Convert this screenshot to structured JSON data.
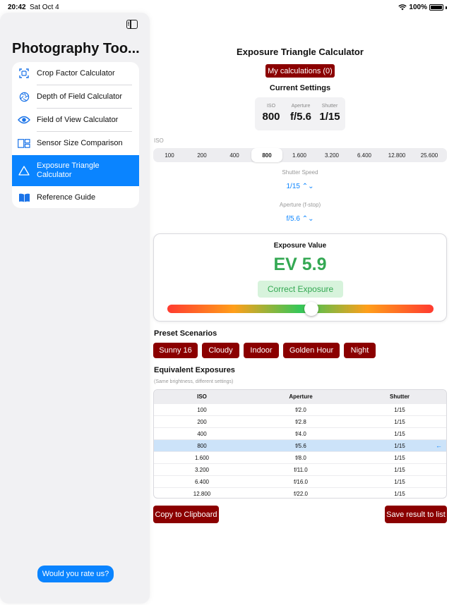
{
  "status": {
    "time": "20:42",
    "date": "Sat Oct 4",
    "battery": "100%"
  },
  "sidebar": {
    "title": "Photography Too...",
    "items": [
      {
        "label": "Crop Factor Calculator",
        "icon": "crop-icon"
      },
      {
        "label": "Depth of Field Calculator",
        "icon": "aperture-icon"
      },
      {
        "label": "Field of View Calculator",
        "icon": "eye-icon"
      },
      {
        "label": "Sensor Size Comparison",
        "icon": "sensor-compare-icon"
      },
      {
        "label": "Exposure Triangle Calculator",
        "icon": "triangle-icon",
        "selected": true
      },
      {
        "label": "Reference Guide",
        "icon": "book-icon"
      }
    ],
    "rate_button": "Would you rate us?"
  },
  "main": {
    "title": "Exposure Triangle Calculator",
    "my_calcs_button": "My calculations (0)",
    "current_settings": {
      "title": "Current Settings",
      "iso_label": "ISO",
      "iso_value": "800",
      "aperture_label": "Aperture",
      "aperture_value": "f/5.6",
      "shutter_label": "Shutter",
      "shutter_value": "1/15"
    },
    "iso": {
      "label": "ISO",
      "options": [
        "100",
        "200",
        "400",
        "800",
        "1.600",
        "3.200",
        "6.400",
        "12.800",
        "25.600"
      ],
      "selected": "800"
    },
    "shutter": {
      "label": "Shutter Speed",
      "value": "1/15 ⌃⌄"
    },
    "aperture": {
      "label": "Aperture (f-stop)",
      "value": "f/5.6 ⌃⌄"
    },
    "exposure": {
      "title": "Exposure Value",
      "value": "EV 5.9",
      "status": "Correct Exposure",
      "meter_fraction": 0.54,
      "colors": {
        "green": "#34a853",
        "status_bg": "#d7f3dc"
      }
    },
    "presets": {
      "title": "Preset Scenarios",
      "items": [
        "Sunny 16",
        "Cloudy",
        "Indoor",
        "Golden Hour",
        "Night"
      ]
    },
    "equivalent": {
      "title": "Equivalent Exposures",
      "note": "(Same brightness, different settings)",
      "headers": [
        "ISO",
        "Aperture",
        "Shutter"
      ],
      "rows": [
        [
          "100",
          "f/2.0",
          "1/15"
        ],
        [
          "200",
          "f/2.8",
          "1/15"
        ],
        [
          "400",
          "f/4.0",
          "1/15"
        ],
        [
          "800",
          "f/5.6",
          "1/15"
        ],
        [
          "1.600",
          "f/8.0",
          "1/15"
        ],
        [
          "3.200",
          "f/11.0",
          "1/15"
        ],
        [
          "6.400",
          "f/16.0",
          "1/15"
        ],
        [
          "12.800",
          "f/22.0",
          "1/15"
        ]
      ],
      "current_marker": "←"
    },
    "copy_button": "Copy to Clipboard",
    "save_button": "Save result to list"
  },
  "colors": {
    "accent": "#0a84ff",
    "brand_button": "#8b0000"
  }
}
